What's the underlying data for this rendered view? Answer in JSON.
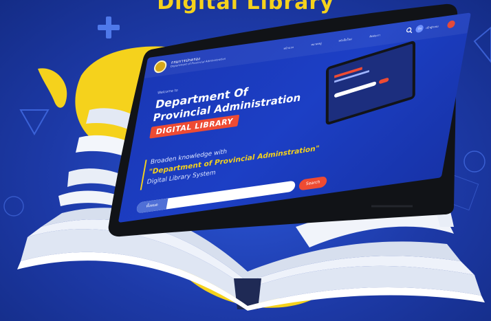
{
  "headline": "Digital Library",
  "tablet": {
    "header": {
      "brand_name": "กรมการปกครอง",
      "brand_sub": "Department of Provincial Administration",
      "nav_items": [
        "หน้าแรก",
        "หมวดหมู่",
        "หนังสือใหม่",
        "ติดต่อเรา"
      ],
      "search_icon": "search-icon",
      "lang": "TH",
      "user_label": "เข้าสู่ระบบ"
    },
    "hero": {
      "welcome": "Welcome to",
      "title_line1": "Department Of",
      "title_line2": "Provincial Administration",
      "badge": "DIGITAL LIBRARY",
      "tagline1": "Broaden knowledge with",
      "tagline2": "\"Department of Provincial Adminstration\"",
      "tagline3": "Digital Library System"
    },
    "search": {
      "category": "ทั้งหมด",
      "placeholder": "",
      "button_label": "Search"
    }
  },
  "colors": {
    "background": "#1d3aa8",
    "accent_yellow": "#f5d21c",
    "accent_red": "#ee4b33",
    "screen_blue": "#1c3fc5"
  }
}
